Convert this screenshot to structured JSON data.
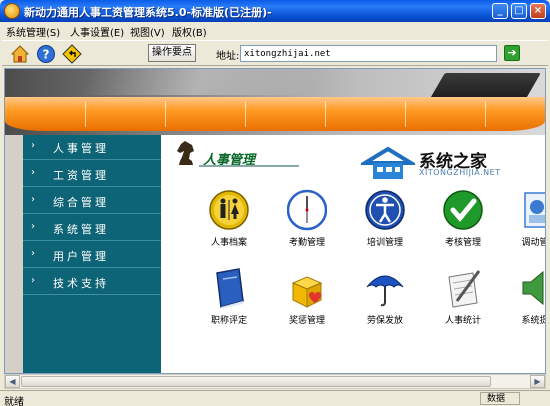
{
  "window": {
    "title": "新动力通用人事工资管理系统5.0-标准版(已注册)-",
    "minimize_glyph": "_",
    "maximize_glyph": "□",
    "close_glyph": "×"
  },
  "menu": [
    {
      "label": "系统管理(S)"
    },
    {
      "label": "人事设置(E)"
    },
    {
      "label": "视图(V)"
    },
    {
      "label": "版权(B)"
    }
  ],
  "toolbar": {
    "icons": [
      "home-icon",
      "help-icon",
      "back-icon"
    ],
    "ops_button": "操作要点",
    "address_label": "地址:",
    "address_value": "xitongzhijai.net",
    "go_glyph": "➔"
  },
  "sidebar": {
    "items": [
      {
        "label": "人事管理"
      },
      {
        "label": "工资管理"
      },
      {
        "label": "综合管理"
      },
      {
        "label": "系统管理"
      },
      {
        "label": "用户管理"
      },
      {
        "label": "技术支持"
      }
    ],
    "arrow_glyph": "›"
  },
  "section": {
    "title": "人事管理"
  },
  "logo": {
    "text": "系统之家",
    "url": "XITONGZHIJIA.NET"
  },
  "modules": [
    {
      "label": "人事档案",
      "icon": "restroom-people-icon",
      "color": "#c9a400"
    },
    {
      "label": "考勤管理",
      "icon": "clock-icon",
      "color": "#2a62c9"
    },
    {
      "label": "培训管理",
      "icon": "accessibility-person-icon",
      "color": "#1f4fb0"
    },
    {
      "label": "考核管理",
      "icon": "checkmark-icon",
      "color": "#1f9a2a"
    },
    {
      "label": "调动管",
      "icon": "transfer-icon",
      "color": "#3a7ad0"
    },
    {
      "label": "职称评定",
      "icon": "book-icon",
      "color": "#2b5fbf"
    },
    {
      "label": "奖惩管理",
      "icon": "gift-box-icon",
      "color": "#e0b000"
    },
    {
      "label": "劳保发放",
      "icon": "umbrella-icon",
      "color": "#1e52c0"
    },
    {
      "label": "人事统计",
      "icon": "pen-paper-icon",
      "color": "#888888"
    },
    {
      "label": "系统提",
      "icon": "speaker-icon",
      "color": "#3f9a3f"
    }
  ],
  "status": {
    "text": "就绪",
    "indicator": "数据"
  },
  "colors": {
    "titlebar": "#0b53d6",
    "sidebar": "#0d6476",
    "banner_orange": "#ff9a22"
  }
}
